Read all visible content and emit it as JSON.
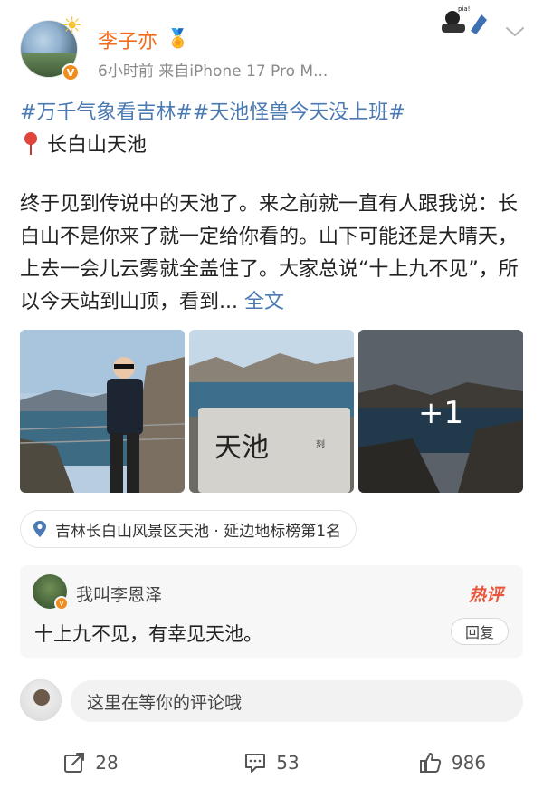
{
  "post": {
    "author": "李子亦",
    "meta": "6小时前  来自iPhone 17 Pro M...",
    "hashtags": "#万千气象看吉林##天池怪兽今天没上班#",
    "location_line": "长白山天池",
    "body": "终于见到传说中的天池了。来之前就一直有人跟我说：长白山不是你来了就一定给你看的。山下可能还是大晴天，上去一会儿云雾就全盖住了。大家总说“十上九不见”，所以今天站到山顶，看到...",
    "more_label": "全文",
    "extra_photo_count": "+1",
    "photo_sign_text": "天池",
    "location_chip": "吉林长白山风景区天池 · 延边地标榜第1名"
  },
  "hot_comment": {
    "name": "我叫李恩泽",
    "tag": "热评",
    "text": "十上九不见，有幸见天池。",
    "reply_label": "回复"
  },
  "composer": {
    "placeholder": "这里在等你的评论哦"
  },
  "actions": {
    "share_count": "28",
    "comment_count": "53",
    "like_count": "986"
  },
  "icons": [
    "sun-icon",
    "verified-icon",
    "medal-icon",
    "chevron-down-icon",
    "location-pin-icon",
    "share-icon",
    "comment-icon",
    "like-icon"
  ],
  "colors": {
    "username": "#f06b1d",
    "link": "#4a79b3",
    "hot": "#e8553a"
  }
}
